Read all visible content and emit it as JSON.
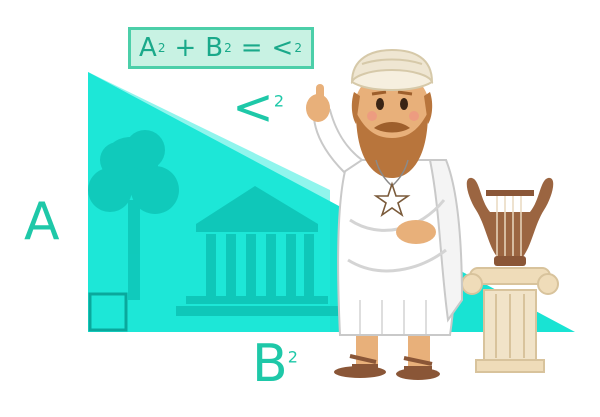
{
  "formula": {
    "a": "A",
    "plus": "+",
    "b": "B",
    "equals": "=",
    "c": "<",
    "exp": "2"
  },
  "side_labels": {
    "hypotenuse": "<",
    "hypotenuse_exp": "2",
    "vertical": "A",
    "horizontal": "B",
    "horizontal_exp": "2"
  },
  "colors": {
    "triangle": "#19e3d3",
    "triangle_dark": "#0fc7b9",
    "label": "#1ec8a8",
    "formula_bg": "#c8f2e3",
    "formula_border": "#4ccfa9",
    "toga": "#ffffff",
    "skin": "#e8b07a",
    "beard": "#b8753c",
    "turban": "#efe6d2",
    "lyre": "#9b6541",
    "column": "#f1e3c8"
  },
  "icons": [
    "pentagram-icon",
    "lyre-icon",
    "temple-icon",
    "tree-icon",
    "right-angle-icon"
  ]
}
